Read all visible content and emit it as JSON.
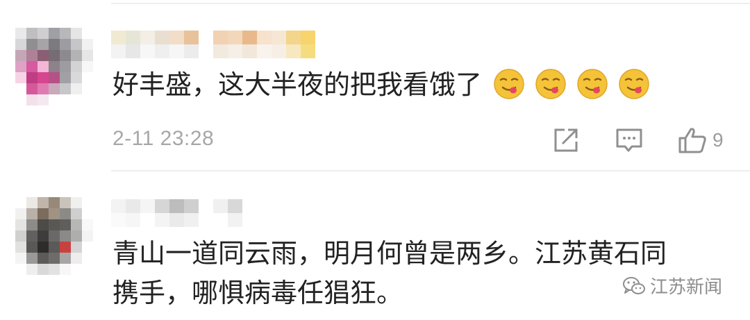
{
  "comments": [
    {
      "text": "好丰盛，这大半夜的把我看饿了",
      "emoji_icons": [
        "yum-face-icon",
        "yum-face-icon",
        "yum-face-icon",
        "yum-face-icon"
      ],
      "timestamp": "2-11 23:28",
      "like_count": "9"
    },
    {
      "text_line1": "青山一道同云雨，明月何曾是两乡。江苏黄石同",
      "text_line2": "携手，哪惧病毒任猖狂。"
    }
  ],
  "watermark": {
    "text": "江苏新闻"
  },
  "colors": {
    "text": "#222222",
    "meta": "#a7a7a7",
    "divider": "#eeeeee",
    "emoji_face": "#f4c338"
  }
}
